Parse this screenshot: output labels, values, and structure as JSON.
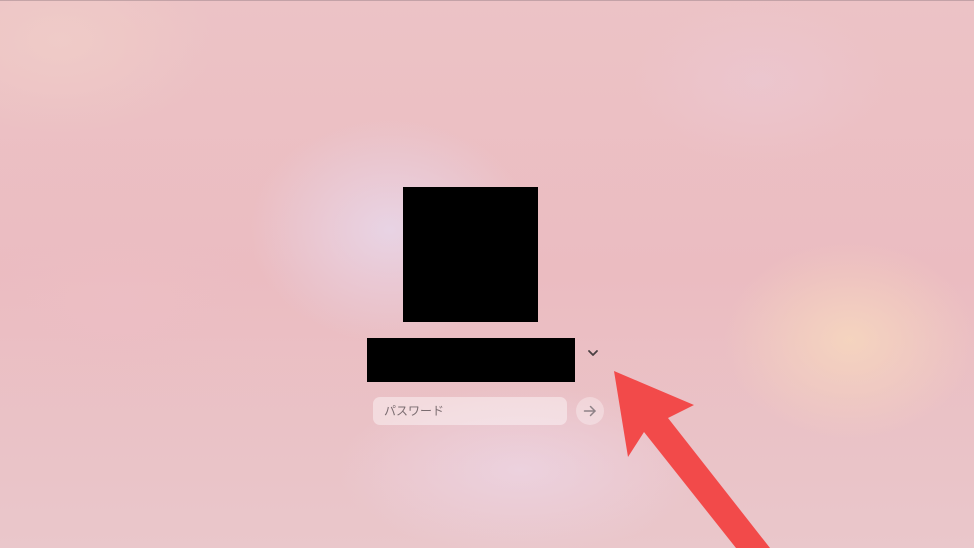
{
  "login": {
    "password_placeholder": "パスワード",
    "password_value": ""
  },
  "icons": {
    "user_switch": "chevron-down-icon",
    "submit": "arrow-right-icon"
  },
  "colors": {
    "annotation_arrow": "#f24a4a"
  }
}
